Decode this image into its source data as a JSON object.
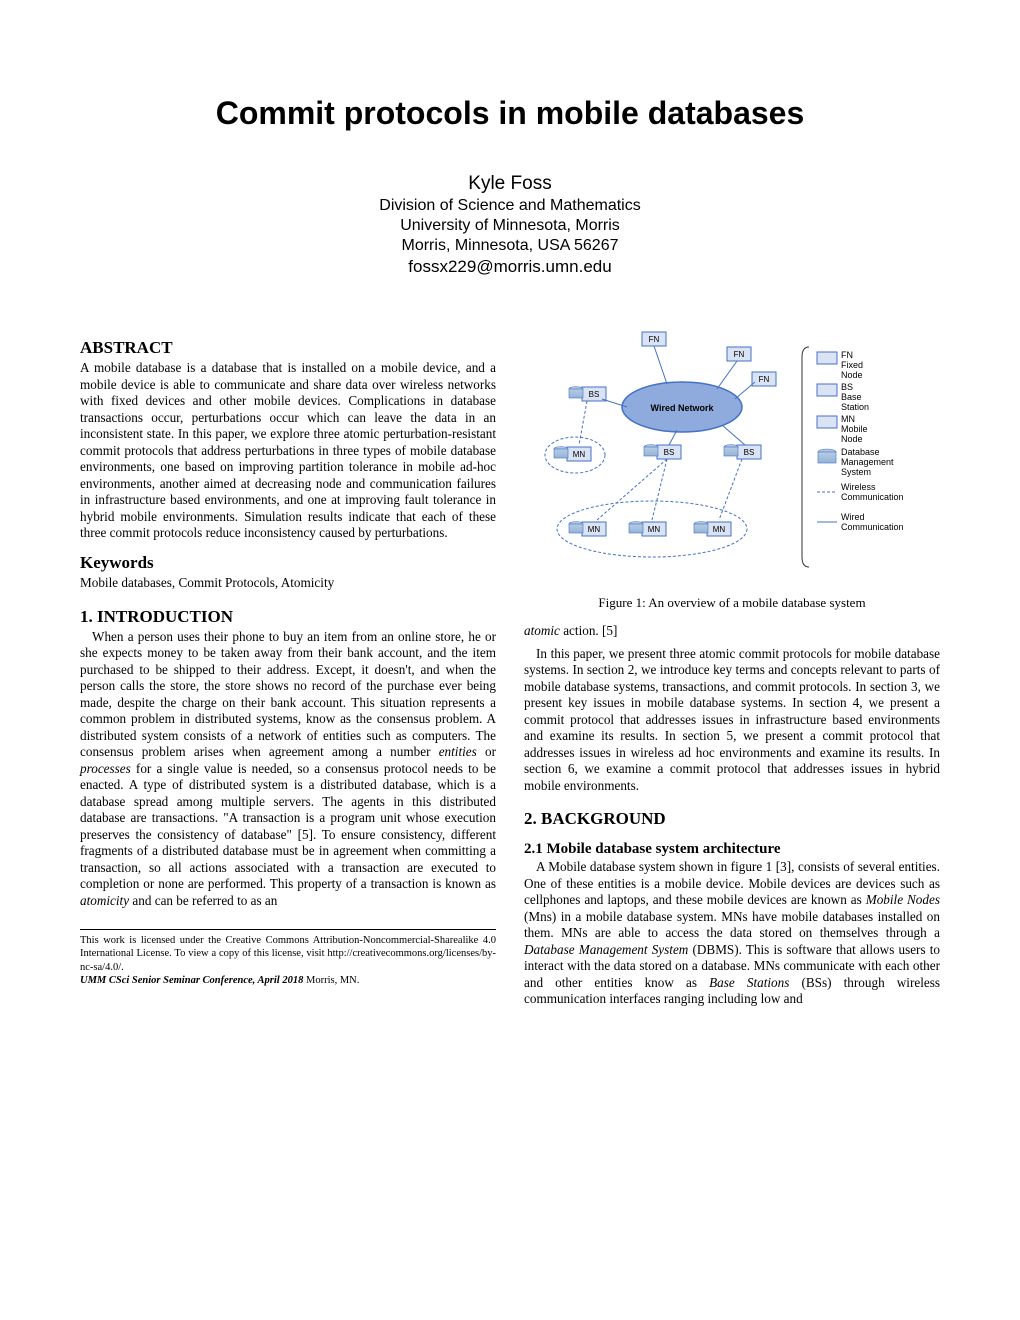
{
  "title": "Commit protocols in mobile databases",
  "author": {
    "name": "Kyle Foss",
    "affil1": "Division of Science and Mathematics",
    "affil2": "University of Minnesota, Morris",
    "affil3": "Morris, Minnesota, USA 56267",
    "email": "fossx229@morris.umn.edu"
  },
  "sections": {
    "abstract_h": "ABSTRACT",
    "abstract": "A mobile database is a database that is installed on a mobile device, and a mobile device is able to communicate and share data over wireless networks with fixed devices and other mobile devices. Complications in database transactions occur, perturbations occur which can leave the data in an inconsistent state. In this paper, we explore three atomic perturbation-resistant commit protocols that address perturbations in three types of mobile database environments, one based on improving partition tolerance in mobile ad-hoc environments, another aimed at decreasing node and communication failures in infrastructure based environments, and one at improving fault tolerance in hybrid mobile environments. Simulation results indicate that each of these three commit protocols reduce inconsistency caused by perturbations.",
    "keywords_h": "Keywords",
    "keywords": "Mobile databases, Commit Protocols, Atomicity",
    "intro_h": "1.   INTRODUCTION",
    "intro_p1": "When a person uses their phone to buy an item from an online store, he or she expects money to be taken away from their bank account, and the item purchased to be shipped to their address. Except, it doesn't, and when the person calls the store, the store shows no record of the purchase ever being made, despite the charge on their bank account. This situation represents a common problem in distributed systems, know as the consensus problem. A distributed system consists of a network of entities such as computers. The consensus problem arises when agreement among a number ",
    "intro_em1": "entities",
    "intro_mid1": " or ",
    "intro_em2": "processes",
    "intro_p1b": " for a single value is needed, so a consensus protocol needs to be enacted. A type of distributed system is a distributed database, which is a database spread among multiple servers. The agents in this distributed database are transactions. \"A transaction is a program unit whose execution preserves the consistency of database\" [5]. To ensure consistency, different fragments of a distributed database must be in agreement when committing a transaction, so all actions associated with a transaction are executed to completion or none are performed. This property of a transaction is known as ",
    "intro_em3": "atomicity",
    "intro_p1c": " and can be referred to as an",
    "col2_em1": "atomic",
    "col2_line1": " action. [5]",
    "intro_p2": "In this paper, we present three atomic commit protocols for mobile database systems. In section 2, we introduce key terms and concepts relevant to parts of mobile database systems, transactions, and commit protocols. In section 3, we present key issues in mobile database systems. In section 4, we present a commit protocol that addresses issues in infrastructure based environments and examine its results. In section 5, we present a commit protocol that addresses issues in wireless ad hoc environments and examine its results. In section 6, we examine a commit protocol that addresses issues in hybrid mobile environments.",
    "bg_h": "2.   BACKGROUND",
    "bg_sub_h": "2.1   Mobile database system architecture",
    "bg_p1a": "A Mobile database system shown in figure 1 [3], consists of several entities. One of these entities is a mobile device. Mobile devices are devices such as cellphones and laptops, and these mobile devices are known as ",
    "bg_em1": "Mobile Nodes",
    "bg_p1b": " (Mns) in a mobile database system. MNs have mobile databases installed on them. MNs are able to access the data stored on themselves through a ",
    "bg_em2": "Database Management System",
    "bg_p1c": " (DBMS). This is software that allows users to interact with the data stored on a database. MNs communicate with each other and other entities know as ",
    "bg_em3": "Base Stations",
    "bg_p1d": " (BSs) through wireless communication interfaces ranging including low and"
  },
  "figure": {
    "caption": "Figure 1: An overview of a mobile database system",
    "labels": {
      "FN": "FN",
      "BS": "BS",
      "MN": "MN",
      "wired": "Wired Network"
    },
    "legend": [
      {
        "box": "FN",
        "txt": "Fixed Node"
      },
      {
        "box": "BS",
        "txt": "Base Station"
      },
      {
        "box": "MN",
        "txt": "Mobile Node"
      },
      {
        "box": "DB",
        "txt": "Database Management System"
      },
      {
        "box": "dash",
        "txt": "Wireless Communication"
      },
      {
        "box": "line",
        "txt": "Wired Communication"
      }
    ]
  },
  "footnote": {
    "line1": "This work is licensed under the Creative Commons Attribution-Noncommercial-Sharealike 4.0 International License. To view a copy of this license, visit http://creativecommons.org/licenses/by-nc-sa/4.0/.",
    "line2a": "UMM CSci Senior Seminar Conference, April 2018",
    "line2b": " Morris, MN."
  }
}
